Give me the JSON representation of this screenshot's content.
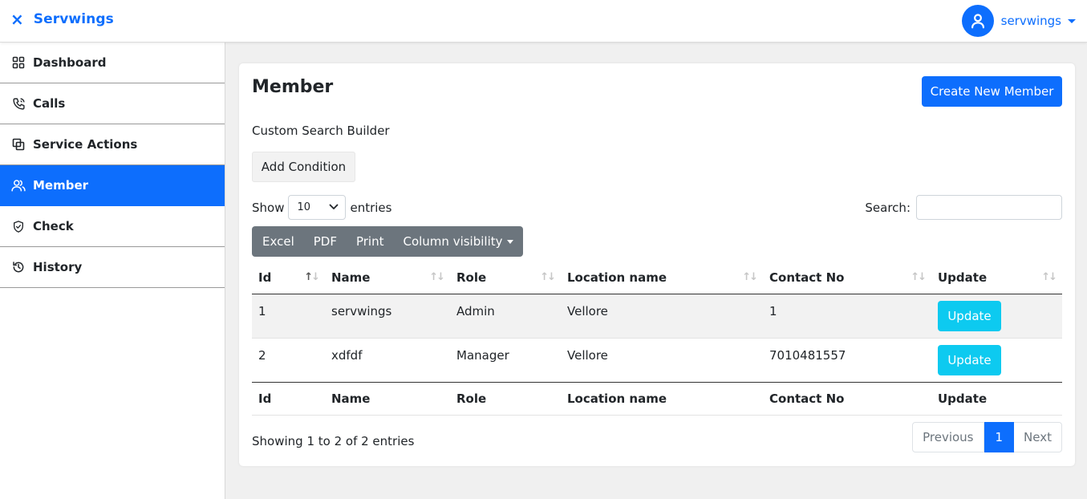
{
  "header": {
    "brand": "Servwings",
    "close_icon": "×",
    "user_name": "servwings"
  },
  "sidebar": {
    "items": [
      {
        "label": "Dashboard",
        "icon": "grid-icon",
        "active": false
      },
      {
        "label": "Calls",
        "icon": "phone-icon",
        "active": false
      },
      {
        "label": "Service Actions",
        "icon": "copy-icon",
        "active": false
      },
      {
        "label": "Member",
        "icon": "users-icon",
        "active": true
      },
      {
        "label": "Check",
        "icon": "shield-check-icon",
        "active": false
      },
      {
        "label": "History",
        "icon": "history-icon",
        "active": false
      }
    ]
  },
  "main": {
    "title": "Member",
    "create_button": "Create New Member",
    "search_builder_title": "Custom Search Builder",
    "add_condition": "Add Condition",
    "length": {
      "show": "Show",
      "value": "10",
      "entries": "entries"
    },
    "search_label": "Search:",
    "search_value": "",
    "export_buttons": {
      "excel": "Excel",
      "pdf": "PDF",
      "print": "Print",
      "colvis": "Column visibility"
    },
    "table": {
      "columns": [
        "Id",
        "Name",
        "Role",
        "Location name",
        "Contact No",
        "Update"
      ],
      "rows": [
        {
          "id": "1",
          "name": "servwings",
          "role": "Admin",
          "location": "Vellore",
          "contact": "1",
          "action": "Update"
        },
        {
          "id": "2",
          "name": "xdfdf",
          "role": "Manager",
          "location": "Vellore",
          "contact": "7010481557",
          "action": "Update"
        }
      ]
    },
    "info": "Showing 1 to 2 of 2 entries",
    "pagination": {
      "previous": "Previous",
      "current": "1",
      "next": "Next"
    }
  },
  "colors": {
    "primary": "#0d6efd",
    "info": "#0dcaf0",
    "secondary": "#6c757d"
  }
}
